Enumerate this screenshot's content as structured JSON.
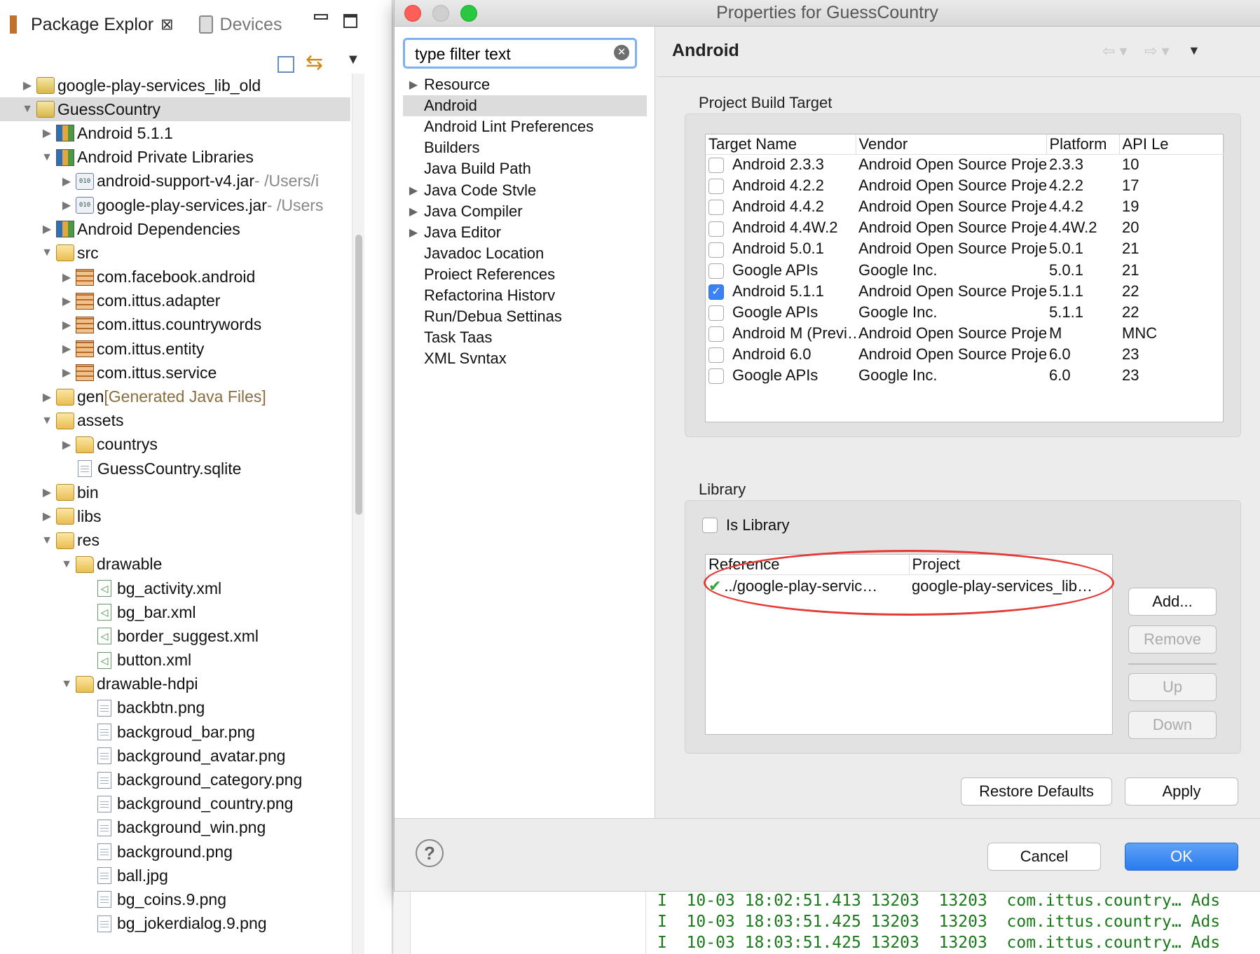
{
  "package_explorer": {
    "tab_label": "Package Explor",
    "close_glyph": "⊠",
    "devices_label": "Devices",
    "tree": [
      {
        "indent": 1,
        "twisty": "▶",
        "icon": "project",
        "label": "google-play-services_lib_old"
      },
      {
        "indent": 1,
        "twisty": "▼",
        "icon": "project",
        "label": "GuessCountry",
        "selected": true
      },
      {
        "indent": 2,
        "twisty": "▶",
        "icon": "library",
        "label": "Android 5.1.1"
      },
      {
        "indent": 2,
        "twisty": "▼",
        "icon": "library",
        "label": "Android Private Libraries"
      },
      {
        "indent": 3,
        "twisty": "▶",
        "icon": "jar",
        "label": "android-support-v4.jar",
        "path": " - /Users/i"
      },
      {
        "indent": 3,
        "twisty": "▶",
        "icon": "jar",
        "label": "google-play-services.jar",
        "path": " - /Users"
      },
      {
        "indent": 2,
        "twisty": "▶",
        "icon": "library",
        "label": "Android Dependencies"
      },
      {
        "indent": 2,
        "twisty": "▼",
        "icon": "srcfolder",
        "label": "src"
      },
      {
        "indent": 3,
        "twisty": "▶",
        "icon": "package",
        "label": "com.facebook.android"
      },
      {
        "indent": 3,
        "twisty": "▶",
        "icon": "package",
        "label": "com.ittus.adapter"
      },
      {
        "indent": 3,
        "twisty": "▶",
        "icon": "package",
        "label": "com.ittus.countrywords"
      },
      {
        "indent": 3,
        "twisty": "▶",
        "icon": "package",
        "label": "com.ittus.entity"
      },
      {
        "indent": 3,
        "twisty": "▶",
        "icon": "package",
        "label": "com.ittus.service"
      },
      {
        "indent": 2,
        "twisty": "▶",
        "icon": "srcfolder",
        "label": "gen",
        "decoration": " [Generated Java Files]"
      },
      {
        "indent": 2,
        "twisty": "▼",
        "icon": "srcfolder",
        "label": "assets"
      },
      {
        "indent": 3,
        "twisty": "▶",
        "icon": "folder",
        "label": "countrys"
      },
      {
        "indent": 3,
        "twisty": "",
        "icon": "file",
        "label": "GuessCountry.sqlite"
      },
      {
        "indent": 2,
        "twisty": "▶",
        "icon": "srcfolder",
        "label": "bin"
      },
      {
        "indent": 2,
        "twisty": "▶",
        "icon": "srcfolder",
        "label": "libs"
      },
      {
        "indent": 2,
        "twisty": "▼",
        "icon": "srcfolder",
        "label": "res"
      },
      {
        "indent": 3,
        "twisty": "▼",
        "icon": "folder",
        "label": "drawable"
      },
      {
        "indent": 4,
        "twisty": "",
        "icon": "xml",
        "label": "bg_activity.xml"
      },
      {
        "indent": 4,
        "twisty": "",
        "icon": "xml",
        "label": "bg_bar.xml"
      },
      {
        "indent": 4,
        "twisty": "",
        "icon": "xml",
        "label": "border_suggest.xml"
      },
      {
        "indent": 4,
        "twisty": "",
        "icon": "xml",
        "label": "button.xml"
      },
      {
        "indent": 3,
        "twisty": "▼",
        "icon": "folder",
        "label": "drawable-hdpi"
      },
      {
        "indent": 4,
        "twisty": "",
        "icon": "file",
        "label": "backbtn.png"
      },
      {
        "indent": 4,
        "twisty": "",
        "icon": "file",
        "label": "backgroud_bar.png"
      },
      {
        "indent": 4,
        "twisty": "",
        "icon": "file",
        "label": "background_avatar.png"
      },
      {
        "indent": 4,
        "twisty": "",
        "icon": "file",
        "label": "background_category.png"
      },
      {
        "indent": 4,
        "twisty": "",
        "icon": "file",
        "label": "background_country.png"
      },
      {
        "indent": 4,
        "twisty": "",
        "icon": "file",
        "label": "background_win.png"
      },
      {
        "indent": 4,
        "twisty": "",
        "icon": "file",
        "label": "background.png"
      },
      {
        "indent": 4,
        "twisty": "",
        "icon": "file",
        "label": "ball.jpg"
      },
      {
        "indent": 4,
        "twisty": "",
        "icon": "file",
        "label": "bg_coins.9.png"
      },
      {
        "indent": 4,
        "twisty": "",
        "icon": "file",
        "label": "bg_jokerdialog.9.png"
      }
    ]
  },
  "dialog": {
    "title": "Properties for GuessCountry",
    "filter": {
      "value": "type filter text",
      "clear_glyph": "✕"
    },
    "pages": [
      {
        "label": "Resource",
        "twisty": "▶"
      },
      {
        "label": "Android",
        "twisty": "",
        "selected": true
      },
      {
        "label": "Android Lint Preferences",
        "twisty": ""
      },
      {
        "label": "Builders",
        "twisty": ""
      },
      {
        "label": "Java Build Path",
        "twisty": ""
      },
      {
        "label": "Java Code Stvle",
        "twisty": "▶"
      },
      {
        "label": "Java Compiler",
        "twisty": "▶"
      },
      {
        "label": "Java Editor",
        "twisty": "▶"
      },
      {
        "label": "Javadoc Location",
        "twisty": ""
      },
      {
        "label": "Proiect References",
        "twisty": ""
      },
      {
        "label": "Refactorina Historv",
        "twisty": ""
      },
      {
        "label": "Run/Debua Settinas",
        "twisty": ""
      },
      {
        "label": "Task Taas",
        "twisty": ""
      },
      {
        "label": "XML Svntax",
        "twisty": ""
      }
    ],
    "page_title": "Android",
    "nav": {
      "back": "⇦ ▾",
      "forward": "⇨ ▾",
      "menu": "▼"
    },
    "build_target": {
      "label": "Project Build Target",
      "columns": [
        "Target Name",
        "Vendor",
        "Platform",
        "API Le"
      ],
      "rows": [
        {
          "checked": false,
          "name": "Android 2.3.3",
          "vendor": "Android Open Source Project",
          "platform": "2.3.3",
          "api": "10"
        },
        {
          "checked": false,
          "name": "Android 4.2.2",
          "vendor": "Android Open Source Project",
          "platform": "4.2.2",
          "api": "17"
        },
        {
          "checked": false,
          "name": "Android 4.4.2",
          "vendor": "Android Open Source Project",
          "platform": "4.4.2",
          "api": "19"
        },
        {
          "checked": false,
          "name": "Android 4.4W.2",
          "vendor": "Android Open Source Project",
          "platform": "4.4W.2",
          "api": "20"
        },
        {
          "checked": false,
          "name": "Android 5.0.1",
          "vendor": "Android Open Source Project",
          "platform": "5.0.1",
          "api": "21"
        },
        {
          "checked": false,
          "name": "Google APIs",
          "vendor": "Google Inc.",
          "platform": "5.0.1",
          "api": "21"
        },
        {
          "checked": true,
          "name": "Android 5.1.1",
          "vendor": "Android Open Source Project",
          "platform": "5.1.1",
          "api": "22"
        },
        {
          "checked": false,
          "name": "Google APIs",
          "vendor": "Google Inc.",
          "platform": "5.1.1",
          "api": "22"
        },
        {
          "checked": false,
          "name": "Android M (Previ…",
          "vendor": "Android Open Source Project",
          "platform": "M",
          "api": "MNC"
        },
        {
          "checked": false,
          "name": "Android 6.0",
          "vendor": "Android Open Source Project",
          "platform": "6.0",
          "api": "23"
        },
        {
          "checked": false,
          "name": "Google APIs",
          "vendor": "Google Inc.",
          "platform": "6.0",
          "api": "23"
        }
      ]
    },
    "library": {
      "label": "Library",
      "is_library_label": "Is Library",
      "is_library_checked": false,
      "columns": [
        "Reference",
        "Project"
      ],
      "rows": [
        {
          "reference": "../google-play-servic…",
          "project": "google-play-services_lib…",
          "status_glyph": "✔"
        }
      ],
      "buttons": {
        "add": "Add...",
        "remove": "Remove",
        "up": "Up",
        "down": "Down"
      }
    },
    "restore_defaults": "Restore Defaults",
    "apply": "Apply",
    "cancel": "Cancel",
    "ok": "OK",
    "help_glyph": "?"
  },
  "console": {
    "lines": [
      "I  10-03 18:02:51.413 13203  13203  com.ittus.country… Ads",
      "I  10-03 18:03:51.425 13203  13203  com.ittus.country… Ads",
      "I  10-03 18:03:51.425 13203  13203  com.ittus.country… Ads"
    ]
  },
  "colors": {
    "highlight": "#e53935",
    "primary_button": "#2a7bef",
    "selection": "#dcdcdc"
  }
}
